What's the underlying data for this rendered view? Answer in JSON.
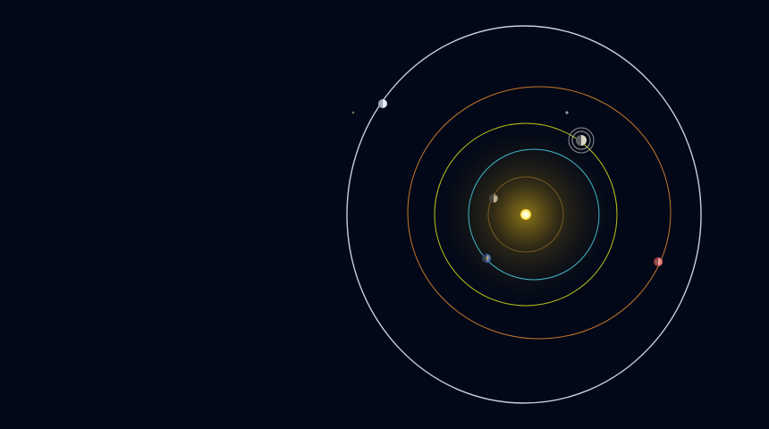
{
  "scene": {
    "background": "#020818",
    "sun": {
      "name": "sun",
      "core_color": "#fffbe0",
      "glow_color": "#ffd21a"
    },
    "orbits": [
      {
        "name": "orbit-1",
        "color": "#8a6a2a",
        "planet_angle_deg": null
      },
      {
        "name": "orbit-2",
        "color": "#3fb8c8",
        "planet_angle_deg": 215
      },
      {
        "name": "orbit-3",
        "color": "#b8c21a",
        "planet_angle_deg": 162
      },
      {
        "name": "orbit-4",
        "color": "#c8782a",
        "planet_angle_deg": 345
      },
      {
        "name": "orbit-5",
        "color": "#c8cce0",
        "planet_angle_deg": 145
      }
    ],
    "planets": [
      {
        "name": "rocky-planet",
        "orbit": "orbit-3",
        "color": "#9a8a6a"
      },
      {
        "name": "blue-planet",
        "orbit": "orbit-2",
        "color": "#4a6ea8"
      },
      {
        "name": "red-planet",
        "orbit": "orbit-4",
        "color": "#e07070"
      },
      {
        "name": "ringed-planet",
        "orbit": "orbit-3b",
        "color": "#d8d8c8"
      },
      {
        "name": "ice-planet",
        "orbit": "orbit-5",
        "color": "#e8ecf4"
      }
    ]
  }
}
